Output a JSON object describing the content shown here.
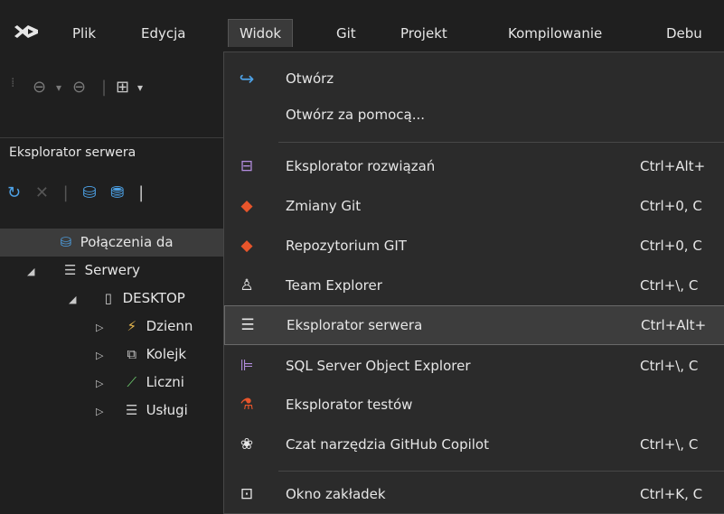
{
  "menubar": {
    "items": [
      "Plik",
      "Edycja",
      "Widok",
      "Git",
      "Projekt",
      "Kompilowanie",
      "Debu"
    ]
  },
  "panel": {
    "title": "Eksplorator serwera",
    "tree": [
      {
        "label": "Połączenia da",
        "icon": "database-connection-icon"
      },
      {
        "label": "Serwery",
        "icon": "server-icon"
      },
      {
        "label": "DESKTOP",
        "icon": "computer-icon"
      },
      {
        "label": "Dzienn",
        "icon": "event-log-icon"
      },
      {
        "label": "Kolejk",
        "icon": "message-queue-icon"
      },
      {
        "label": "Liczni",
        "icon": "performance-counter-icon"
      },
      {
        "label": "Usługi",
        "icon": "services-icon"
      }
    ]
  },
  "dropdown": {
    "items": [
      {
        "label": "Otwórz",
        "shortcut": "",
        "icon": "open-arrow-icon"
      },
      {
        "label": "Otwórz za pomocą...",
        "shortcut": "",
        "icon": ""
      },
      {
        "label": "Eksplorator rozwiązań",
        "shortcut": "Ctrl+Alt+",
        "icon": "solution-explorer-icon"
      },
      {
        "label": "Zmiany Git",
        "shortcut": "Ctrl+0, C",
        "icon": "git-changes-icon"
      },
      {
        "label": "Repozytorium GIT",
        "shortcut": "Ctrl+0, C",
        "icon": "git-repository-icon"
      },
      {
        "label": "Team Explorer",
        "shortcut": "Ctrl+\\, C",
        "icon": "team-explorer-icon"
      },
      {
        "label": "Eksplorator serwera",
        "shortcut": "Ctrl+Alt+",
        "icon": "server-explorer-icon"
      },
      {
        "label": "SQL Server Object Explorer",
        "shortcut": "Ctrl+\\, C",
        "icon": "sql-object-explorer-icon"
      },
      {
        "label": "Eksplorator testów",
        "shortcut": "",
        "icon": "test-explorer-icon"
      },
      {
        "label": "Czat narzędzia GitHub Copilot",
        "shortcut": "Ctrl+\\, C",
        "icon": "copilot-icon"
      },
      {
        "label": "Okno zakładek",
        "shortcut": "Ctrl+K, C",
        "icon": "bookmarks-icon"
      }
    ]
  },
  "colors": {
    "accent": "#4ea3e8",
    "git": "#e8552b",
    "background": "#1f1f1f",
    "menu": "#2b2b2b"
  }
}
